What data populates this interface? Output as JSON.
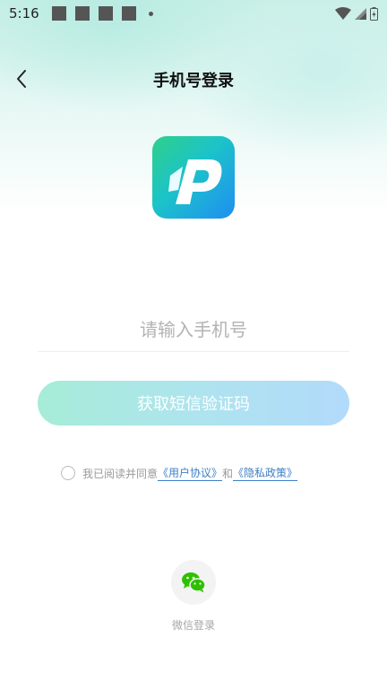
{
  "status_bar": {
    "time": "5:16",
    "icons": [
      "notification-square",
      "notification-square",
      "notification-square",
      "notification-square",
      "notification-dot",
      "wifi-icon",
      "signal-icon",
      "battery-icon"
    ]
  },
  "header": {
    "title": "手机号登录",
    "back_icon": "chevron-left-icon"
  },
  "logo": {
    "icon": "app-logo-p"
  },
  "phone_input": {
    "placeholder": "请输入手机号",
    "value": ""
  },
  "sms_button": {
    "label": "获取短信验证码"
  },
  "agreement": {
    "checked": false,
    "prefix": "我已阅读并同意",
    "user_agreement": "《用户协议》",
    "and_text": "和",
    "privacy_policy": "《隐私政策》"
  },
  "third_party": {
    "wechat_label": "微信登录",
    "wechat_icon": "wechat-icon"
  },
  "colors": {
    "button_gradient_start": "#a6ecd7",
    "button_gradient_end": "#b2dafb",
    "link": "#3f7fc4",
    "wechat_green": "#2dc100"
  }
}
